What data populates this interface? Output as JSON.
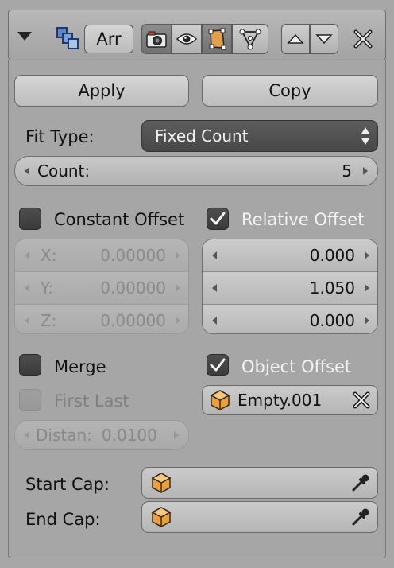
{
  "header": {
    "collapse_icon": "triangle-down-icon",
    "modifier_type_icon": "array-modifier-icon",
    "modifier_name": "Arr",
    "render_icon": "camera-icon",
    "viewport_icon": "eye-icon",
    "editmode_icon": "edit-mode-icon",
    "cage_icon": "vertex-triangle-icon",
    "move_up_icon": "triangle-up-icon",
    "move_down_icon": "triangle-down-icon",
    "close_icon": "close-icon"
  },
  "actions": {
    "apply": "Apply",
    "copy": "Copy"
  },
  "fit": {
    "label": "Fit Type:",
    "value": "Fixed Count"
  },
  "count": {
    "label": "Count:",
    "value": "5"
  },
  "constant_offset": {
    "label": "Constant Offset",
    "checked": false,
    "x": {
      "label": "X:",
      "value": "0.00000"
    },
    "y": {
      "label": "Y:",
      "value": "0.00000"
    },
    "z": {
      "label": "Z:",
      "value": "0.00000"
    }
  },
  "relative_offset": {
    "label": "Relative Offset",
    "checked": true,
    "x": "0.000",
    "y": "1.050",
    "z": "0.000"
  },
  "merge": {
    "label": "Merge",
    "checked": false
  },
  "first_last": {
    "label": "First Last",
    "checked": false
  },
  "distance": {
    "label": "Distan:",
    "value": "0.0100"
  },
  "object_offset": {
    "label": "Object Offset",
    "checked": true,
    "object": "Empty.001"
  },
  "start_cap": {
    "label": "Start Cap:",
    "value": ""
  },
  "end_cap": {
    "label": "End Cap:",
    "value": ""
  },
  "colors": {
    "panel": "#a6a6a6",
    "dropdown": "#4f4f4f",
    "checkbox": "#444444",
    "cube_orange": "#e8a040"
  }
}
